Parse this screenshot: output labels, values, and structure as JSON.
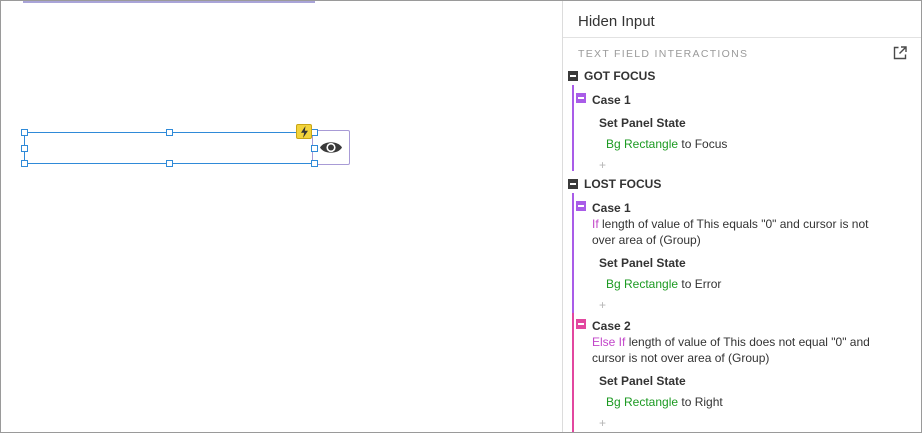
{
  "panel": {
    "title": "Hiden Input",
    "section_label": "TEXT FIELD INTERACTIONS",
    "popout_icon": "popout-icon"
  },
  "colors": {
    "selection": "#2f8ad8",
    "case_purple": "#a95ce8",
    "case_pink": "#e2479f",
    "keyword": "#c246c9",
    "target_green": "#1c9a22",
    "lightning_badge": "#f2d33b"
  },
  "events": [
    {
      "label": "GOT FOCUS",
      "cases": [
        {
          "label": "Case 1",
          "condition_keyword": "",
          "condition": "",
          "action": "Set Panel State",
          "target": "Bg Rectangle",
          "target_suffix": " to Focus",
          "add": "+"
        }
      ]
    },
    {
      "label": "LOST FOCUS",
      "cases": [
        {
          "label": "Case 1",
          "condition_keyword": "If",
          "condition": " length of value of This equals \"0\" and cursor is not over area of (Group)",
          "action": "Set Panel State",
          "target": "Bg Rectangle",
          "target_suffix": " to Error",
          "add": "+"
        },
        {
          "label": "Case 2",
          "condition_keyword": "Else If",
          "condition": " length of value of This does not equal \"0\" and cursor is not over area of (Group)",
          "action": "Set Panel State",
          "target": "Bg Rectangle",
          "target_suffix": " to Right",
          "add": "+"
        }
      ]
    }
  ]
}
